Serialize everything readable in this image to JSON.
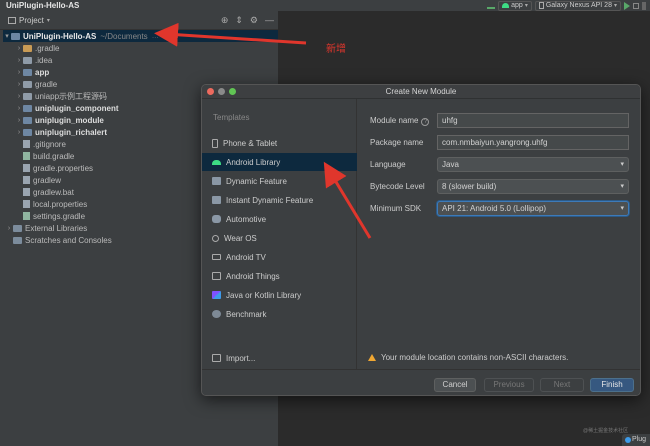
{
  "window": {
    "title": "UniPlugin-Hello-AS"
  },
  "run_toolbar": {
    "run_config": "app",
    "device": "Galaxy Nexus API 28"
  },
  "project_panel": {
    "tab_label": "Project",
    "items": [
      {
        "label": "UniPlugin-Hello-AS",
        "path": "~/Documents",
        "hint": "…",
        "kind": "root"
      },
      {
        "label": ".gradle",
        "kind": "folder"
      },
      {
        "label": ".idea",
        "kind": "folder"
      },
      {
        "label": "app",
        "kind": "module"
      },
      {
        "label": "gradle",
        "kind": "folder"
      },
      {
        "label": "uniapp示例工程源码",
        "kind": "folder"
      },
      {
        "label": "uniplugin_component",
        "kind": "module"
      },
      {
        "label": "uniplugin_module",
        "kind": "module"
      },
      {
        "label": "uniplugin_richalert",
        "kind": "module"
      },
      {
        "label": ".gitignore",
        "kind": "file"
      },
      {
        "label": "build.gradle",
        "kind": "file"
      },
      {
        "label": "gradle.properties",
        "kind": "file"
      },
      {
        "label": "gradlew",
        "kind": "file"
      },
      {
        "label": "gradlew.bat",
        "kind": "file"
      },
      {
        "label": "local.properties",
        "kind": "file"
      },
      {
        "label": "settings.gradle",
        "kind": "file"
      },
      {
        "label": "External Libraries",
        "kind": "folder"
      },
      {
        "label": "Scratches and Consoles",
        "kind": "folder"
      }
    ]
  },
  "annotation": {
    "text": "新增",
    "color": "#e0362c"
  },
  "dialog": {
    "title": "Create New Module",
    "templates_heading": "Templates",
    "templates": [
      {
        "label": "Phone & Tablet",
        "icon": "phone-icon"
      },
      {
        "label": "Android Library",
        "icon": "android-icon"
      },
      {
        "label": "Dynamic Feature",
        "icon": "feature-icon"
      },
      {
        "label": "Instant Dynamic Feature",
        "icon": "instant-feature-icon"
      },
      {
        "label": "Automotive",
        "icon": "car-icon"
      },
      {
        "label": "Wear OS",
        "icon": "watch-icon"
      },
      {
        "label": "Android TV",
        "icon": "tv-icon"
      },
      {
        "label": "Android Things",
        "icon": "things-icon"
      },
      {
        "label": "Java or Kotlin Library",
        "icon": "kotlin-icon"
      },
      {
        "label": "Benchmark",
        "icon": "benchmark-icon"
      }
    ],
    "import_label": "Import...",
    "fields": {
      "module_name": {
        "label": "Module name",
        "value": "uhfg"
      },
      "package_name": {
        "label": "Package name",
        "value": "com.nmbaiyun.yangrong.uhfg"
      },
      "language": {
        "label": "Language",
        "value": "Java"
      },
      "bytecode_level": {
        "label": "Bytecode Level",
        "value": "8 (slower build)"
      },
      "minimum_sdk": {
        "label": "Minimum SDK",
        "value": "API 21: Android 5.0 (Lollipop)"
      }
    },
    "warning": "Your module location contains non-ASCII characters.",
    "buttons": {
      "cancel": "Cancel",
      "previous": "Previous",
      "next": "Next",
      "finish": "Finish"
    }
  },
  "watermark": "@稀土掘金技术社区",
  "corner_label": "Plug"
}
